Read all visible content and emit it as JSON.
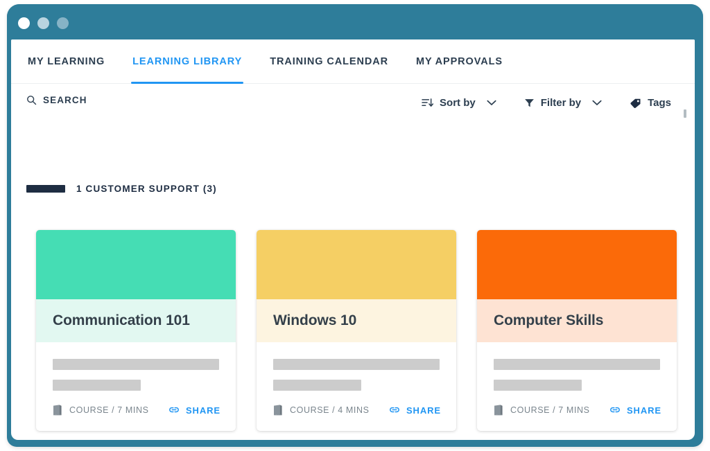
{
  "window": {
    "frame_color": "#2E7D9A",
    "traffic_lights": [
      {
        "name": "close",
        "color": "#FFFFFF"
      },
      {
        "name": "minimize",
        "color": "#B9D4E0"
      },
      {
        "name": "maximize",
        "color": "#86B3C6"
      }
    ]
  },
  "nav": {
    "tabs": [
      {
        "label": "MY LEARNING",
        "active": false
      },
      {
        "label": "LEARNING LIBRARY",
        "active": true
      },
      {
        "label": "TRAINING CALENDAR",
        "active": false
      },
      {
        "label": "MY APPROVALS",
        "active": false
      }
    ],
    "active_color": "#2196F3",
    "inactive_color": "#2C3E50"
  },
  "toolbar": {
    "search_label": "SEARCH",
    "search_icon": "search-icon",
    "sort_label": "Sort by",
    "sort_icon": "sort-icon",
    "filter_label": "Filter by",
    "filter_icon": "filter-icon",
    "tags_label": "Tags",
    "tags_icon": "tag-icon",
    "caret_icon": "chevron-down-icon"
  },
  "section": {
    "title": "1 CUSTOMER SUPPORT (3)",
    "bar_color": "#1E2D42"
  },
  "cards": [
    {
      "title": "Communication 101",
      "banner_color": "#45DDB4",
      "band_color": "#E2F8F1",
      "meta": "COURSE / 7 MINS",
      "meta_icon": "book-icon",
      "share_label": "SHARE",
      "share_icon": "link-icon"
    },
    {
      "title": "Windows 10",
      "banner_color": "#F5CF64",
      "band_color": "#FDF4E0",
      "meta": "COURSE / 4 MINS",
      "meta_icon": "book-icon",
      "share_label": "SHARE",
      "share_icon": "link-icon"
    },
    {
      "title": "Computer Skills",
      "banner_color": "#FB6A09",
      "band_color": "#FEE3D3",
      "meta": "COURSE / 7 MINS",
      "meta_icon": "book-icon",
      "share_label": "SHARE",
      "share_icon": "link-icon"
    }
  ]
}
